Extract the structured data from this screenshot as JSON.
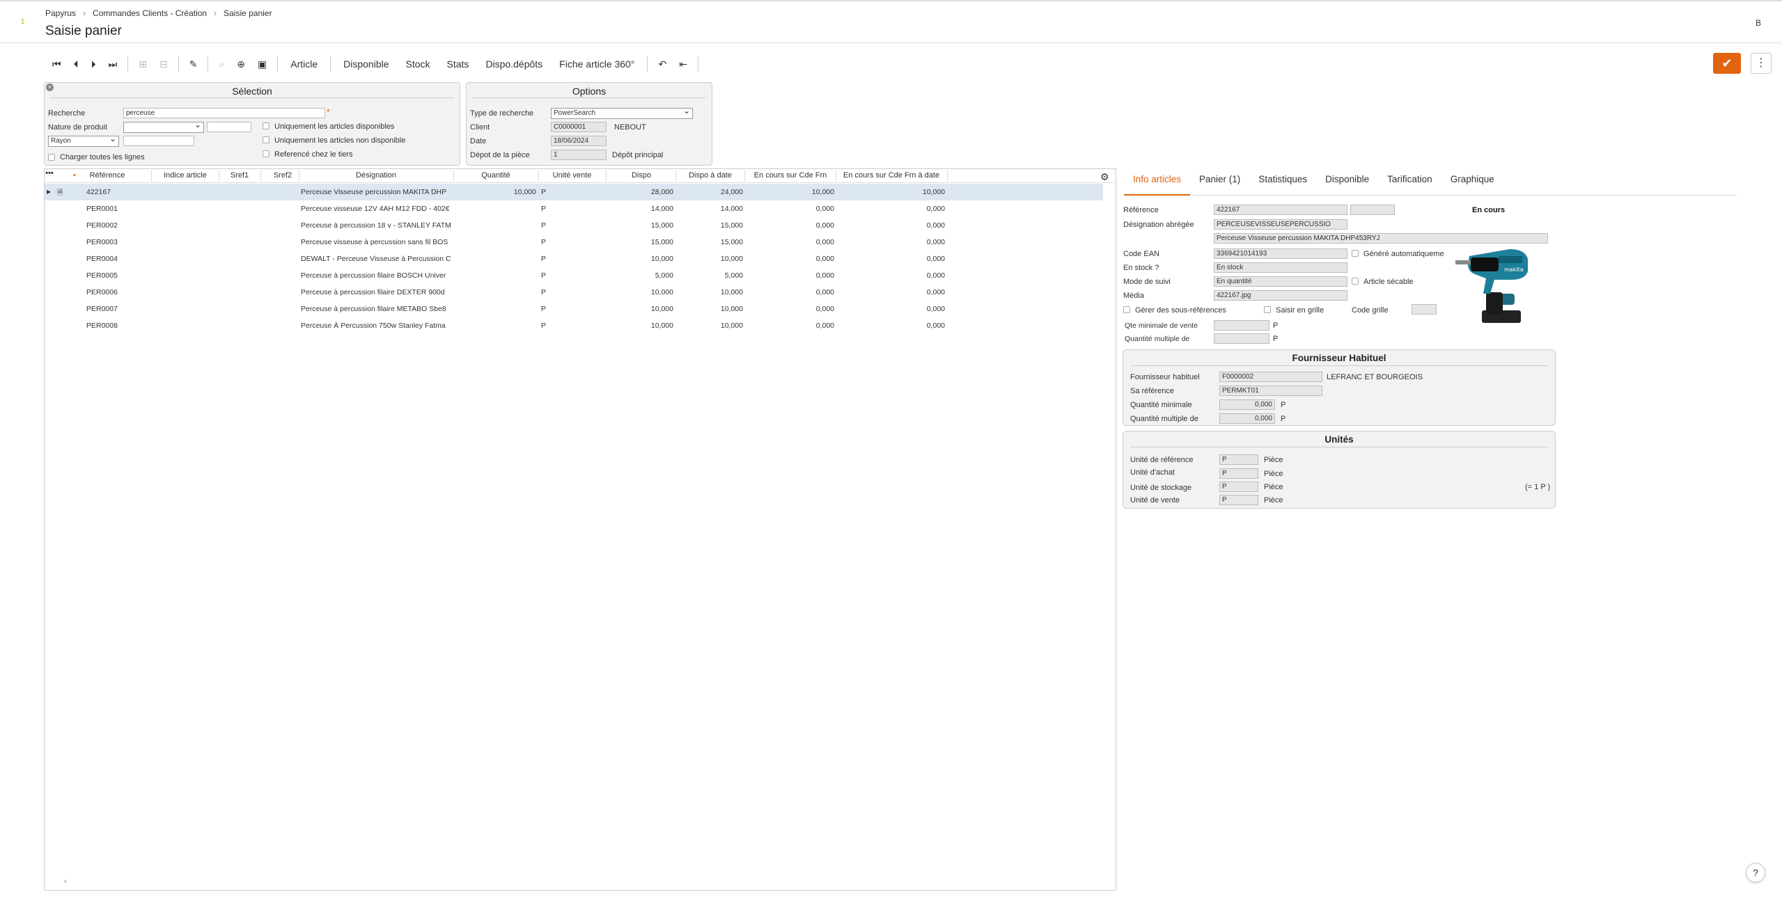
{
  "breadcrumb": [
    "Papyrus",
    "Commandes Clients - Création",
    "Saisie panier"
  ],
  "page_title": "Saisie panier",
  "user_initial": "B",
  "toolbar": {
    "buttons": [
      "Article",
      "Disponible",
      "Stock",
      "Stats",
      "Dispo.dépôts",
      "Fiche article 360°"
    ]
  },
  "selection": {
    "title": "Sélection",
    "recherche_label": "Recherche",
    "recherche_value": "perceuse",
    "nature_label": "Nature de produit",
    "rayon_value": "Rayon",
    "only_available": "Uniquement les articles disponibles",
    "only_unavailable": "Uniquement les articles non disponible",
    "referenced_tiers": "Referencé chez le tiers",
    "load_all": "Charger toutes les lignes"
  },
  "options": {
    "title": "Options",
    "type_label": "Type de recherche",
    "type_value": "PowerSearch",
    "client_label": "Client",
    "client_code": "C0000001",
    "client_name": "NEBOUT",
    "date_label": "Date",
    "date_value": "18/06/2024",
    "depot_label": "Dépot de la pièce",
    "depot_code": "1",
    "depot_name": "Dépôt principal"
  },
  "grid": {
    "columns": [
      "Référence",
      "Indice article",
      "Sref1",
      "Sref2",
      "Désignation",
      "Quantité",
      "Unité vente",
      "Dispo",
      "Dispo à date",
      "En cours sur Cde Frn",
      "En cours sur Cde Frn à date"
    ],
    "rows": [
      {
        "ref": "422167",
        "des": "Perceuse Visseuse percussion MAKITA DHP",
        "qty": "10,000",
        "unit": "P",
        "dispo": "28,000",
        "dispo_date": "24,000",
        "cde": "10,000",
        "cde_date": "10,000"
      },
      {
        "ref": "PER0001",
        "des": "Perceuse visseuse 12V 4AH M12 FDD - 402€",
        "qty": "",
        "unit": "P",
        "dispo": "14,000",
        "dispo_date": "14,000",
        "cde": "0,000",
        "cde_date": "0,000"
      },
      {
        "ref": "PER0002",
        "des": "Perceuse à percussion 18 v - STANLEY FATM",
        "qty": "",
        "unit": "P",
        "dispo": "15,000",
        "dispo_date": "15,000",
        "cde": "0,000",
        "cde_date": "0,000"
      },
      {
        "ref": "PER0003",
        "des": "Perceuse visseuse à percussion sans fil BOS",
        "qty": "",
        "unit": "P",
        "dispo": "15,000",
        "dispo_date": "15,000",
        "cde": "0,000",
        "cde_date": "0,000"
      },
      {
        "ref": "PER0004",
        "des": "DEWALT - Perceuse Visseuse à Percussion C",
        "qty": "",
        "unit": "P",
        "dispo": "10,000",
        "dispo_date": "10,000",
        "cde": "0,000",
        "cde_date": "0,000"
      },
      {
        "ref": "PER0005",
        "des": "Perceuse à percussion filaire BOSCH Univer",
        "qty": "",
        "unit": "P",
        "dispo": "5,000",
        "dispo_date": "5,000",
        "cde": "0,000",
        "cde_date": "0,000"
      },
      {
        "ref": "PER0006",
        "des": "Perceuse à percussion filaire DEXTER 900d",
        "qty": "",
        "unit": "P",
        "dispo": "10,000",
        "dispo_date": "10,000",
        "cde": "0,000",
        "cde_date": "0,000"
      },
      {
        "ref": "PER0007",
        "des": "Perceuse à percussion filaire METABO Sbe8",
        "qty": "",
        "unit": "P",
        "dispo": "10,000",
        "dispo_date": "10,000",
        "cde": "0,000",
        "cde_date": "0,000"
      },
      {
        "ref": "PER0008",
        "des": "Perceuse À Percussion 750w Stanley Fatma",
        "qty": "",
        "unit": "P",
        "dispo": "10,000",
        "dispo_date": "10,000",
        "cde": "0,000",
        "cde_date": "0,000"
      }
    ]
  },
  "tabs": [
    "Info articles",
    "Panier (1)",
    "Statistiques",
    "Disponible",
    "Tarification",
    "Graphique"
  ],
  "info": {
    "reference_label": "Référence",
    "reference_value": "422167",
    "status": "En cours",
    "des_abr_label": "Désignation abrégée",
    "des_abr_value": "PERCEUSEVISSEUSEPERCUSSIO",
    "des_full": "Perceuse Visseuse percussion MAKITA DHP453RYJ",
    "ean_label": "Code EAN",
    "ean_value": "3369421014193",
    "ean_auto": "Généré automatiqueme",
    "stock_label": "En stock ?",
    "stock_value": "En stock",
    "suivi_label": "Mode de suivi",
    "suivi_value": "En quantité",
    "secable": "Article sécable",
    "media_label": "Média",
    "media_value": "422167.jpg",
    "sous_ref": "Gérer des sous-références",
    "grille": "Saisir en grille",
    "code_grille": "Code grille",
    "qte_min_label": "Qte minimale de vente",
    "qte_mult_label": "Quantité multiple de",
    "unit_p": "P"
  },
  "fournisseur": {
    "title": "Fournisseur Habituel",
    "frn_label": "Fournisseur habituel",
    "frn_code": "F0000002",
    "frn_name": "LEFRANC ET BOURGEOIS",
    "sa_ref_label": "Sa référence",
    "sa_ref_value": "PERMKT01",
    "qmin_label": "Quantité minimale",
    "qmin_value": "0,000",
    "qmult_label": "Quantité multiple de",
    "qmult_value": "0,000",
    "unit": "P"
  },
  "unites": {
    "title": "Unités",
    "rows": [
      {
        "label": "Unité de référence",
        "code": "P",
        "name": "Pièce",
        "extra": ""
      },
      {
        "label": "Unité d'achat",
        "code": "P",
        "name": "Pièce",
        "extra": ""
      },
      {
        "label": "Unité de stockage",
        "code": "P",
        "name": "Pièce",
        "extra": "(= 1 P )"
      },
      {
        "label": "Unité de vente",
        "code": "P",
        "name": "Pièce",
        "extra": ""
      }
    ]
  },
  "help": "?",
  "colors": {
    "accent": "#e2640e",
    "selected_row": "#dde6f3"
  }
}
